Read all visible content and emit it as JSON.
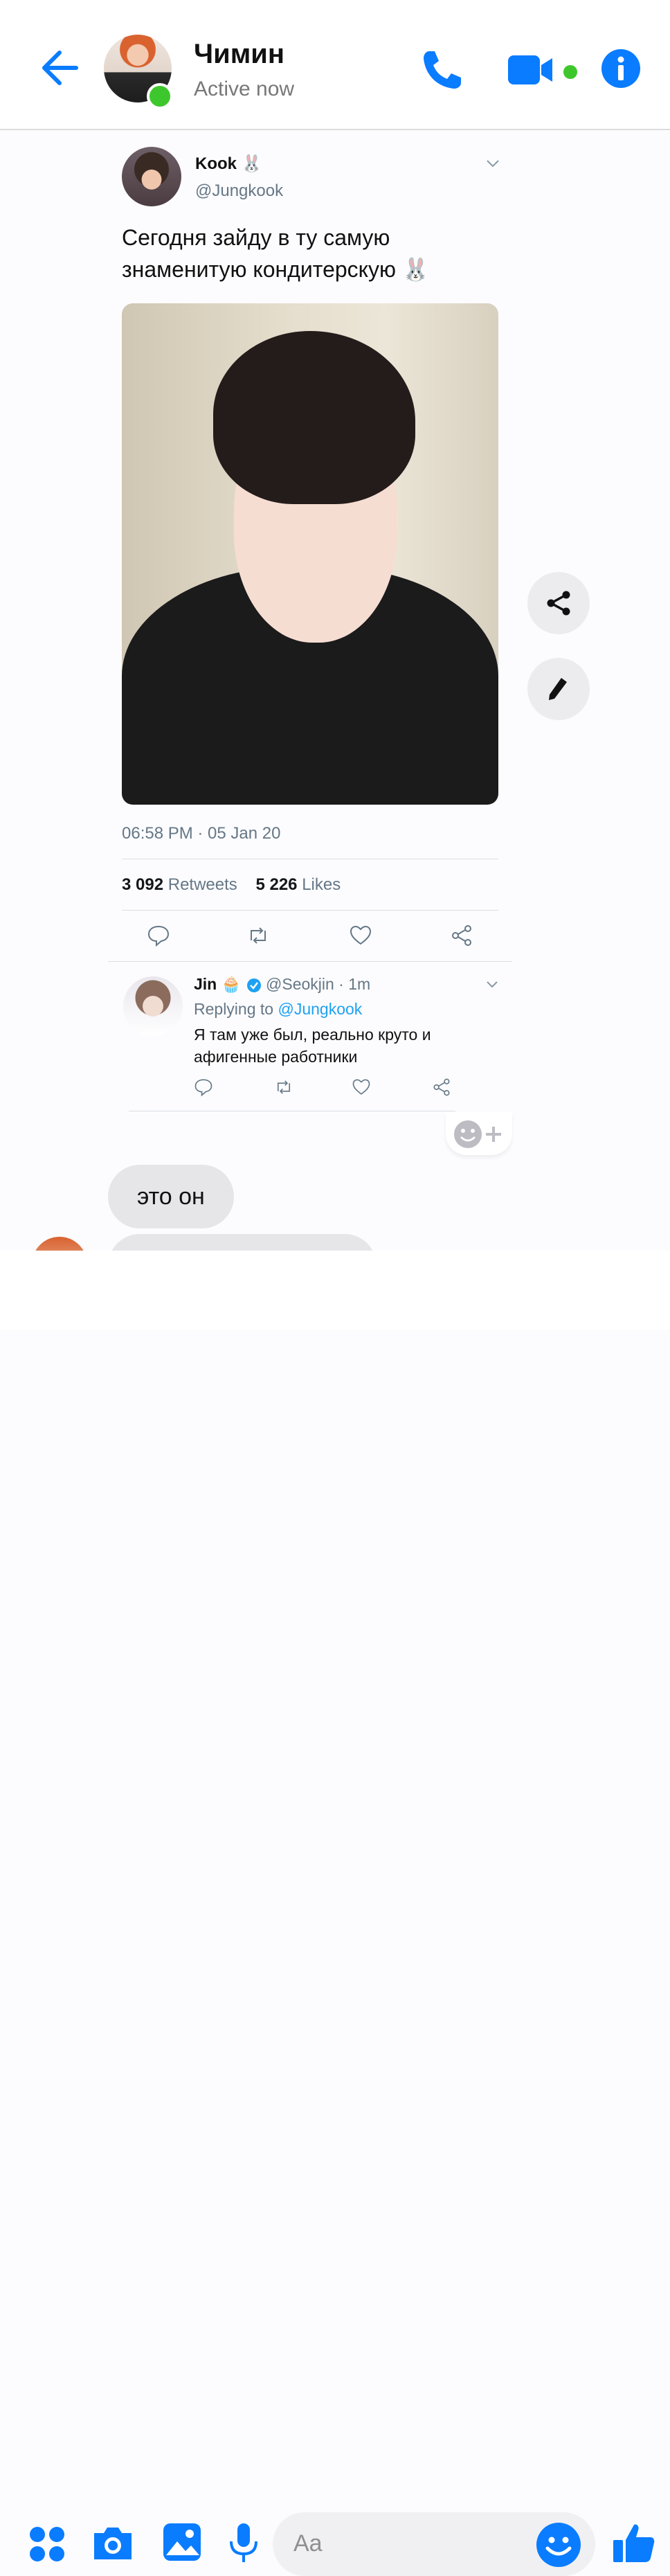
{
  "header": {
    "contact_name": "Чимин",
    "status": "Active now"
  },
  "tweet": {
    "author": "Kook 🐰",
    "handle": "@Jungkook",
    "text": "Сегодня зайду в ту самую знаменитую кондитерскую 🐰",
    "timestamp": "06:58 PM · 05 Jan 20",
    "retweets_count": "3 092",
    "retweets_label": "Retweets",
    "likes_count": "5 226",
    "likes_label": "Likes"
  },
  "reply": {
    "author": "Jin 🧁",
    "meta": "@Seokjin · 1m",
    "replying_prefix": "Replying to",
    "replying_to": "@Jungkook",
    "text": "Я там уже был, реально круто и афигенные работники"
  },
  "messages": [
    {
      "text": "это он"
    }
  ],
  "composer": {
    "placeholder": "Aa"
  },
  "colors": {
    "accent": "#0a7cff",
    "online": "#3ec72c",
    "link": "#1da1f2"
  }
}
